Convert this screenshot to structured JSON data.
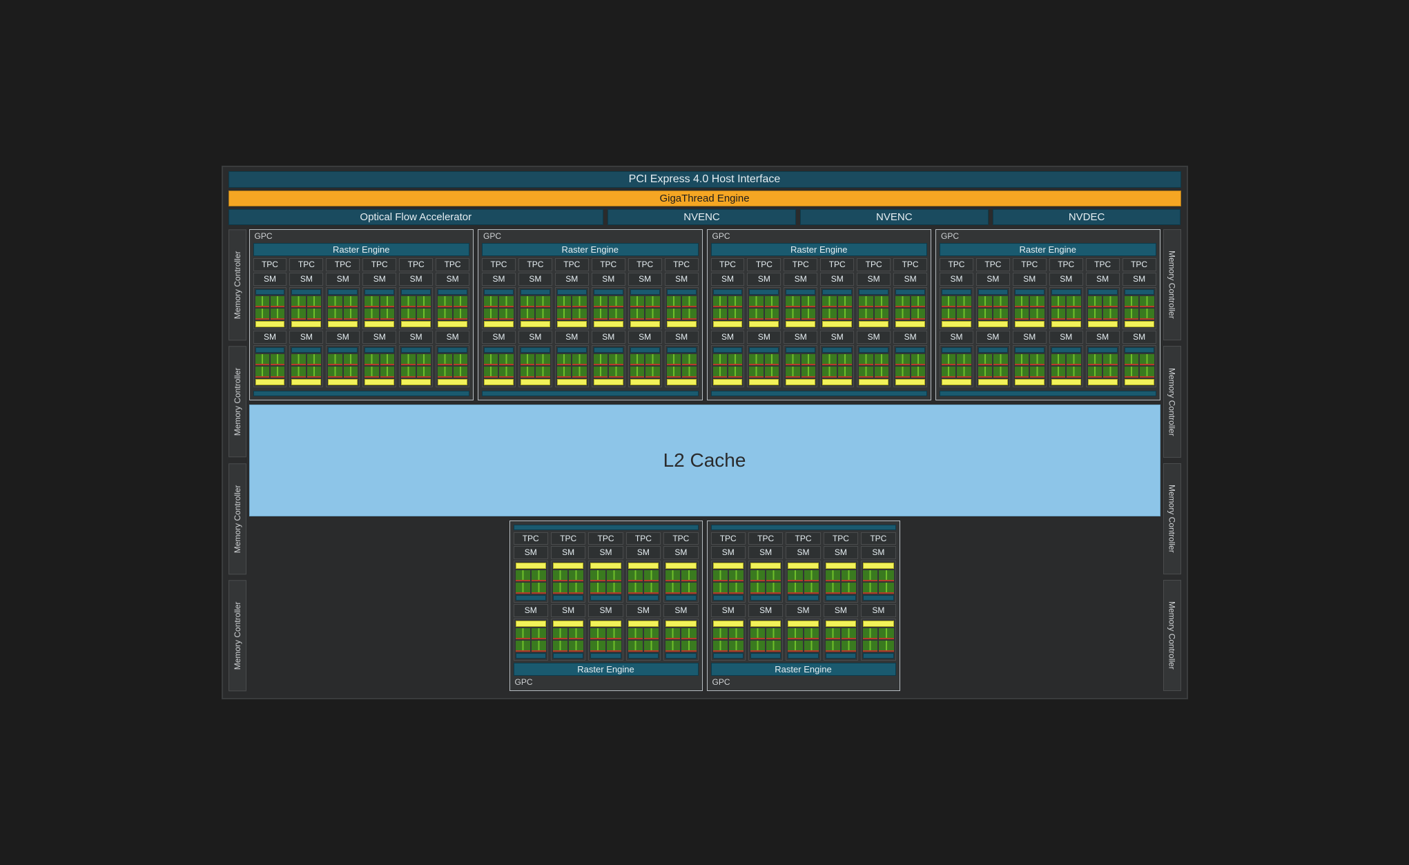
{
  "bars": {
    "pci": "PCI Express 4.0 Host Interface",
    "giga": "GigaThread Engine"
  },
  "engines": {
    "ofa": "Optical Flow Accelerator",
    "nvenc": "NVENC",
    "nvdec": "NVDEC"
  },
  "labels": {
    "memctrl": "Memory Controller",
    "gpc": "GPC",
    "raster": "Raster Engine",
    "tpc": "TPC",
    "sm": "SM",
    "l2": "L2 Cache"
  },
  "layout": {
    "top_gpc_count": 4,
    "top_tpc_per_gpc": 6,
    "bottom_gpc_count": 2,
    "bottom_tpc_per_gpc": 5,
    "sms_per_tpc": 2,
    "mem_controllers_per_side": 4
  },
  "colors": {
    "bg": "#2a2b2c",
    "teal": "#1a5a6f",
    "orange": "#f5a623",
    "l2": "#8dc5e8",
    "green": "#3a7a1f",
    "yellow": "#f2f25a"
  }
}
